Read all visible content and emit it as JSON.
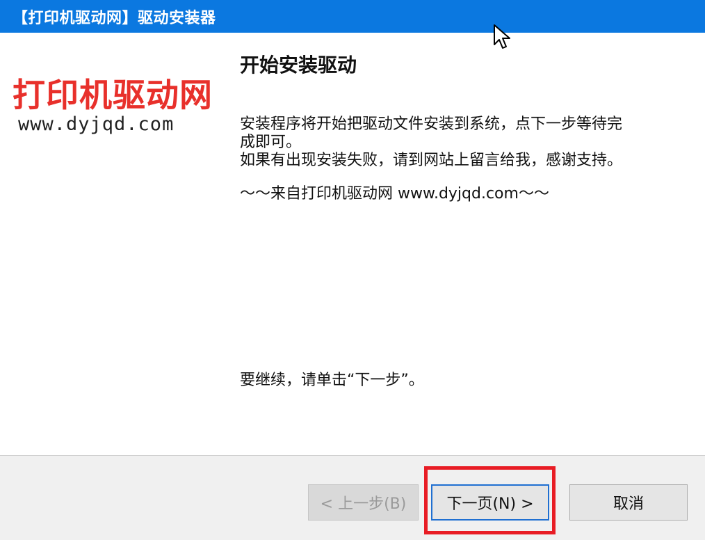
{
  "window": {
    "title": "【打印机驱动网】驱动安装器",
    "titlebar_color": "#0b78e0"
  },
  "logo": {
    "cn_text": "打印机驱动网",
    "url_text": "www.dyjqd.com",
    "cn_color": "#e8302b"
  },
  "content": {
    "heading": "开始安装驱动",
    "paragraph_1": "安装程序将开始把驱动文件安装到系统，点下一步等待完成即可。",
    "paragraph_2": "如果有出现安装失败，请到网站上留言给我，感谢支持。",
    "signature": "～～来自打印机驱动网 www.dyjqd.com～～",
    "continue_text": "要继续，请单击“下一步”。"
  },
  "buttons": {
    "back_label": "< 上一步(B)",
    "next_label": "下一页(N) >",
    "cancel_label": "取消",
    "back_enabled": false
  },
  "annotation": {
    "highlight_color": "#e81c24"
  },
  "cursor": {
    "icon": "arrow-pointer-icon"
  }
}
